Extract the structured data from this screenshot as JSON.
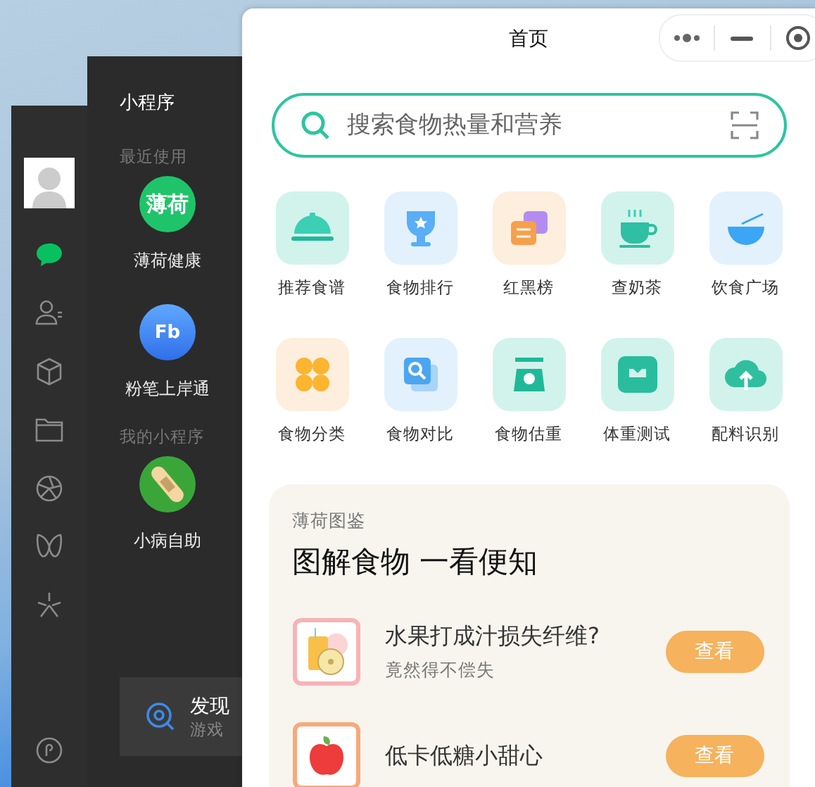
{
  "wechat": {
    "nav": [
      {
        "selected": true
      },
      {
        "selected": false
      },
      {
        "selected": false
      },
      {
        "selected": false
      },
      {
        "selected": false
      },
      {
        "selected": false
      },
      {
        "selected": false
      },
      {
        "selected": false
      }
    ]
  },
  "mini_programs": {
    "title": "小程序",
    "sections": [
      {
        "heading": "最近使用",
        "apps": [
          {
            "name": "薄荷健康",
            "logo_text": "薄荷",
            "kind": "text"
          },
          {
            "name": "粉笔上岸通",
            "logo_text": "Fb",
            "kind": "text"
          }
        ]
      },
      {
        "heading": "我的小程序",
        "apps": [
          {
            "name": "小病自助",
            "kind": "bandage"
          }
        ]
      }
    ],
    "discover": {
      "title": "发现",
      "subtitle": "游戏"
    }
  },
  "window": {
    "title": "首页"
  },
  "search": {
    "placeholder": "搜索食物热量和营养"
  },
  "shortcuts": [
    {
      "label": "推荐食谱"
    },
    {
      "label": "食物排行"
    },
    {
      "label": "红黑榜"
    },
    {
      "label": "查奶茶"
    },
    {
      "label": "饮食广场"
    },
    {
      "label": "食物分类"
    },
    {
      "label": "食物对比"
    },
    {
      "label": "食物估重"
    },
    {
      "label": "体重测试"
    },
    {
      "label": "配料识别"
    }
  ],
  "guide": {
    "label": "薄荷图鉴",
    "headline": "图解食物 一看便知",
    "articles": [
      {
        "title": "水果打成汁损失纤维?",
        "subtitle": "竟然得不偿失",
        "button": "查看",
        "kind": "juice"
      },
      {
        "title": "低卡低糖小甜心",
        "button": "查看",
        "kind": "apple"
      }
    ]
  }
}
